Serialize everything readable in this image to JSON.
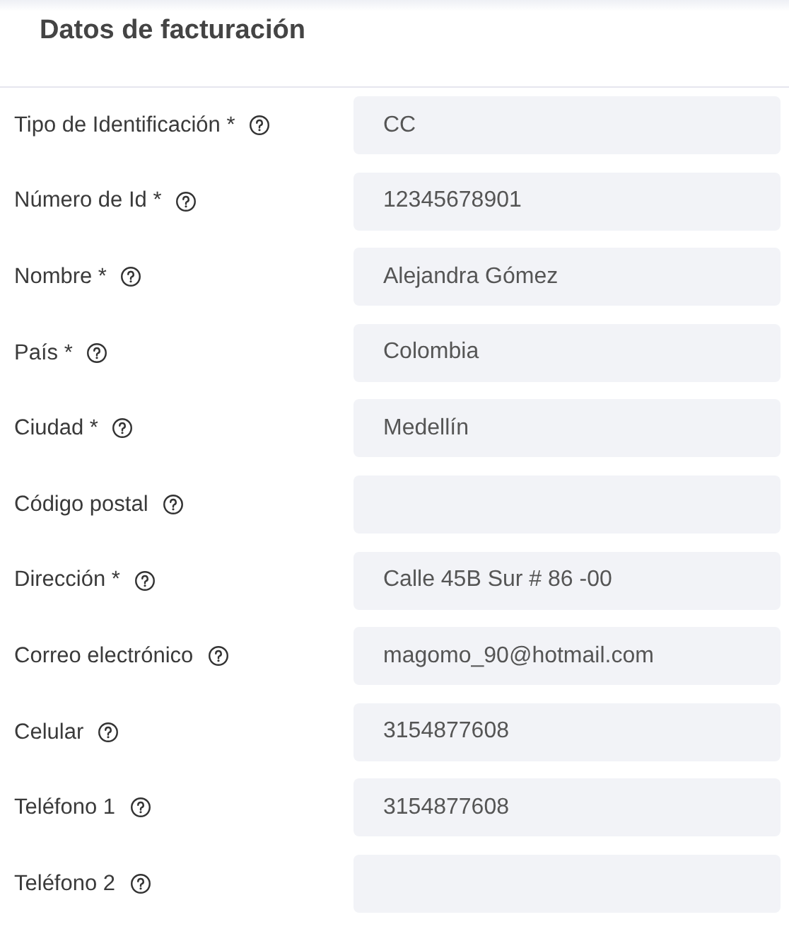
{
  "title": "Datos de facturación",
  "fields": [
    {
      "label": "Tipo de Identificación *",
      "value": "CC"
    },
    {
      "label": "Número de Id *",
      "value": "12345678901"
    },
    {
      "label": "Nombre *",
      "value": "Alejandra Gómez"
    },
    {
      "label": "País *",
      "value": "Colombia"
    },
    {
      "label": "Ciudad *",
      "value": "Medellín"
    },
    {
      "label": "Código postal"
    },
    {
      "label": "Dirección *",
      "value": "Calle 45B Sur # 86 -00"
    },
    {
      "label": "Correo electrónico",
      "value": "magomo_90@hotmail.com"
    },
    {
      "label": "Celular",
      "value": "3154877608"
    },
    {
      "label": "Teléfono 1",
      "value": "3154877608"
    },
    {
      "label": "Teléfono 2"
    }
  ]
}
